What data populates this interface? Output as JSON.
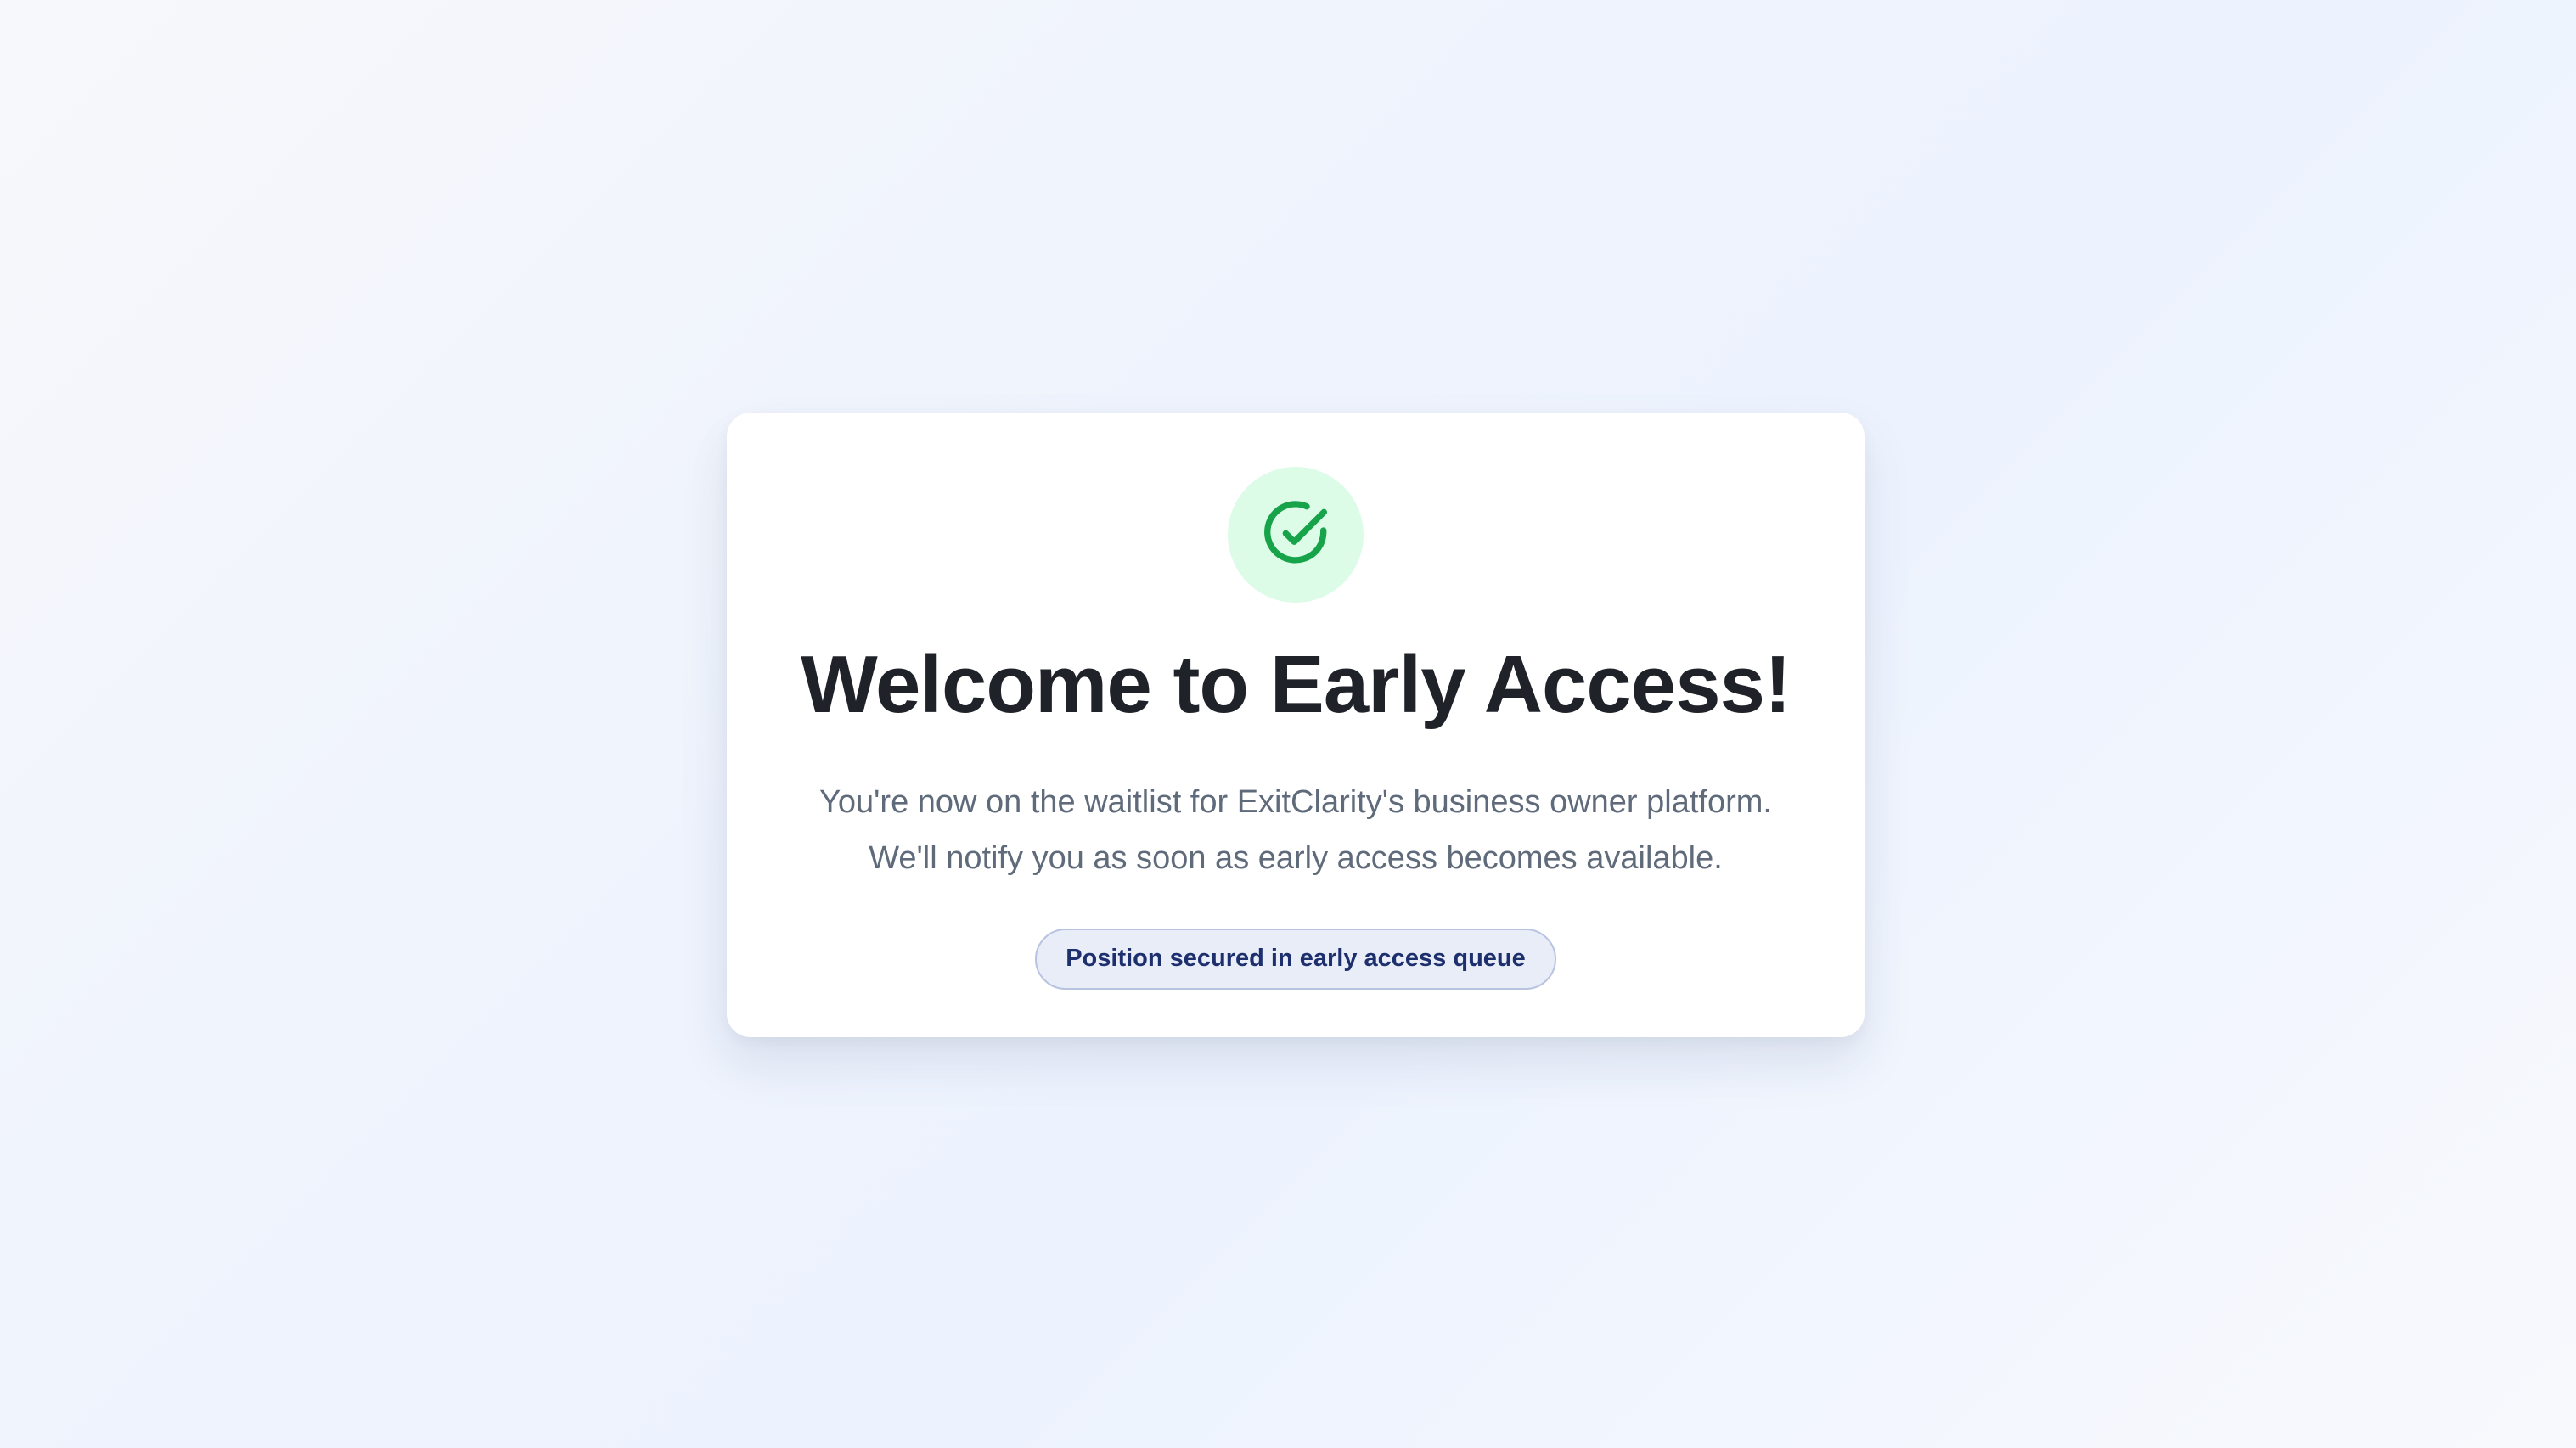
{
  "card": {
    "icon": "check-circle-icon",
    "title": "Welcome to Early Access!",
    "description_line1": "You're now on the waitlist for ExitClarity's business owner platform.",
    "description_line2": "We'll notify you as soon as early access becomes available.",
    "badge_label": "Position secured in early access queue"
  },
  "colors": {
    "success_green": "#16a34a",
    "success_bg": "#dcfce7",
    "badge_text": "#1e2f6e",
    "badge_bg": "#e8edf8"
  }
}
